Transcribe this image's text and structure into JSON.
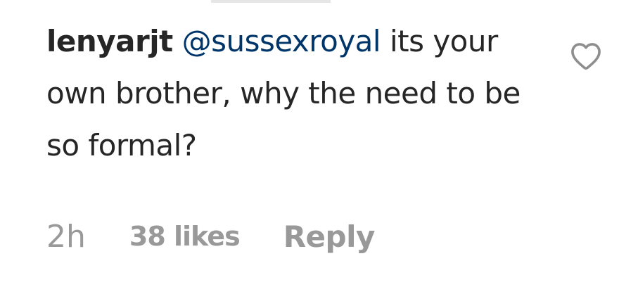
{
  "comment": {
    "username": "lenyarjt",
    "mention": "@sussexroyal",
    "text": "its your own brother, why the need to be so formal?",
    "like_icon": "heart-outline-icon"
  },
  "meta": {
    "timestamp": "2h",
    "likes": "38 likes",
    "reply_label": "Reply"
  },
  "colors": {
    "text": "#262626",
    "mention": "#003569",
    "meta": "#999999",
    "icon": "#8e8e8e"
  }
}
